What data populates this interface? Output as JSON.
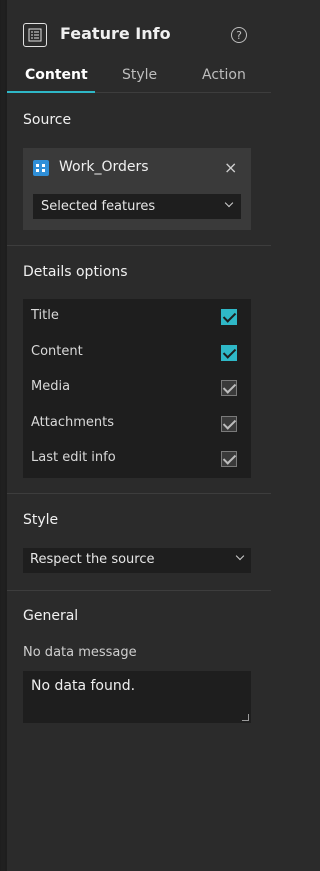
{
  "header": {
    "title": "Feature Info",
    "widget_icon": "feature-info-icon",
    "help_icon": "help-icon",
    "help_glyph": "?"
  },
  "tabs": [
    {
      "label": "Content",
      "active": true
    },
    {
      "label": "Style",
      "active": false
    },
    {
      "label": "Action",
      "active": false
    }
  ],
  "source": {
    "title": "Source",
    "datasource_name": "Work_Orders",
    "datasource_icon": "feature-layer-icon",
    "remove_icon": "close-icon",
    "remove_glyph": "×",
    "selection_mode": "Selected features"
  },
  "details": {
    "title": "Details options",
    "options": [
      {
        "label": "Title",
        "checked": true,
        "enabled": true
      },
      {
        "label": "Content",
        "checked": true,
        "enabled": true
      },
      {
        "label": "Media",
        "checked": true,
        "enabled": false
      },
      {
        "label": "Attachments",
        "checked": true,
        "enabled": false
      },
      {
        "label": "Last edit info",
        "checked": true,
        "enabled": false
      }
    ]
  },
  "style": {
    "title": "Style",
    "selected": "Respect the source"
  },
  "general": {
    "title": "General",
    "no_data_label": "No data message",
    "no_data_value": "No data found."
  },
  "colors": {
    "accent": "#2fb8c7",
    "panel_bg": "#2b2b2b",
    "field_bg": "#1e1e1e"
  }
}
